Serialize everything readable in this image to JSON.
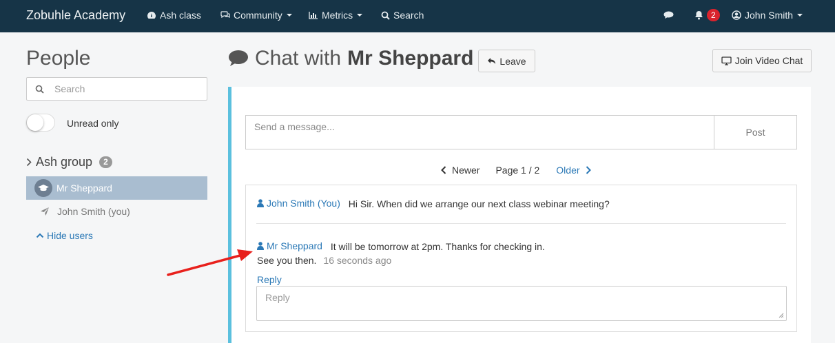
{
  "navbar": {
    "brand": "Zobuhle Academy",
    "class_label": "Ash class",
    "community_label": "Community",
    "metrics_label": "Metrics",
    "search_label": "Search",
    "notification_count": "2",
    "user_name": "John Smith"
  },
  "sidebar": {
    "title": "People",
    "search_placeholder": "Search",
    "unread_label": "Unread only",
    "unread_on": false,
    "group_name": "Ash group",
    "group_count": "2",
    "users": [
      {
        "name": "Mr Sheppard",
        "icon": "graduation-cap-icon",
        "active": true
      },
      {
        "name": "John Smith (you)",
        "icon": "send-icon",
        "active": false
      }
    ],
    "hide_users_label": "Hide users"
  },
  "chat": {
    "title_prefix": "Chat with",
    "title_name": "Mr Sheppard",
    "leave_label": "Leave",
    "video_label": "Join Video Chat",
    "message_placeholder": "Send a message...",
    "post_label": "Post",
    "pager": {
      "newer": "Newer",
      "page": "Page 1 / 2",
      "older": "Older"
    },
    "messages": [
      {
        "author": "John Smith (You)",
        "text": "Hi Sir. When did we arrange our next class webinar meeting?"
      },
      {
        "author": "Mr Sheppard",
        "text_line1": "It will be tomorrow at 2pm. Thanks for checking in.",
        "text_line2": "See you then.",
        "time": "16 seconds ago"
      }
    ],
    "reply_label": "Reply",
    "reply_placeholder": "Reply"
  },
  "colors": {
    "navbar_bg": "#163447",
    "accent_link": "#2a78b6",
    "panel_border": "#5bc0de",
    "notification_badge": "#d9232d",
    "annotation_arrow": "#e8201c"
  }
}
